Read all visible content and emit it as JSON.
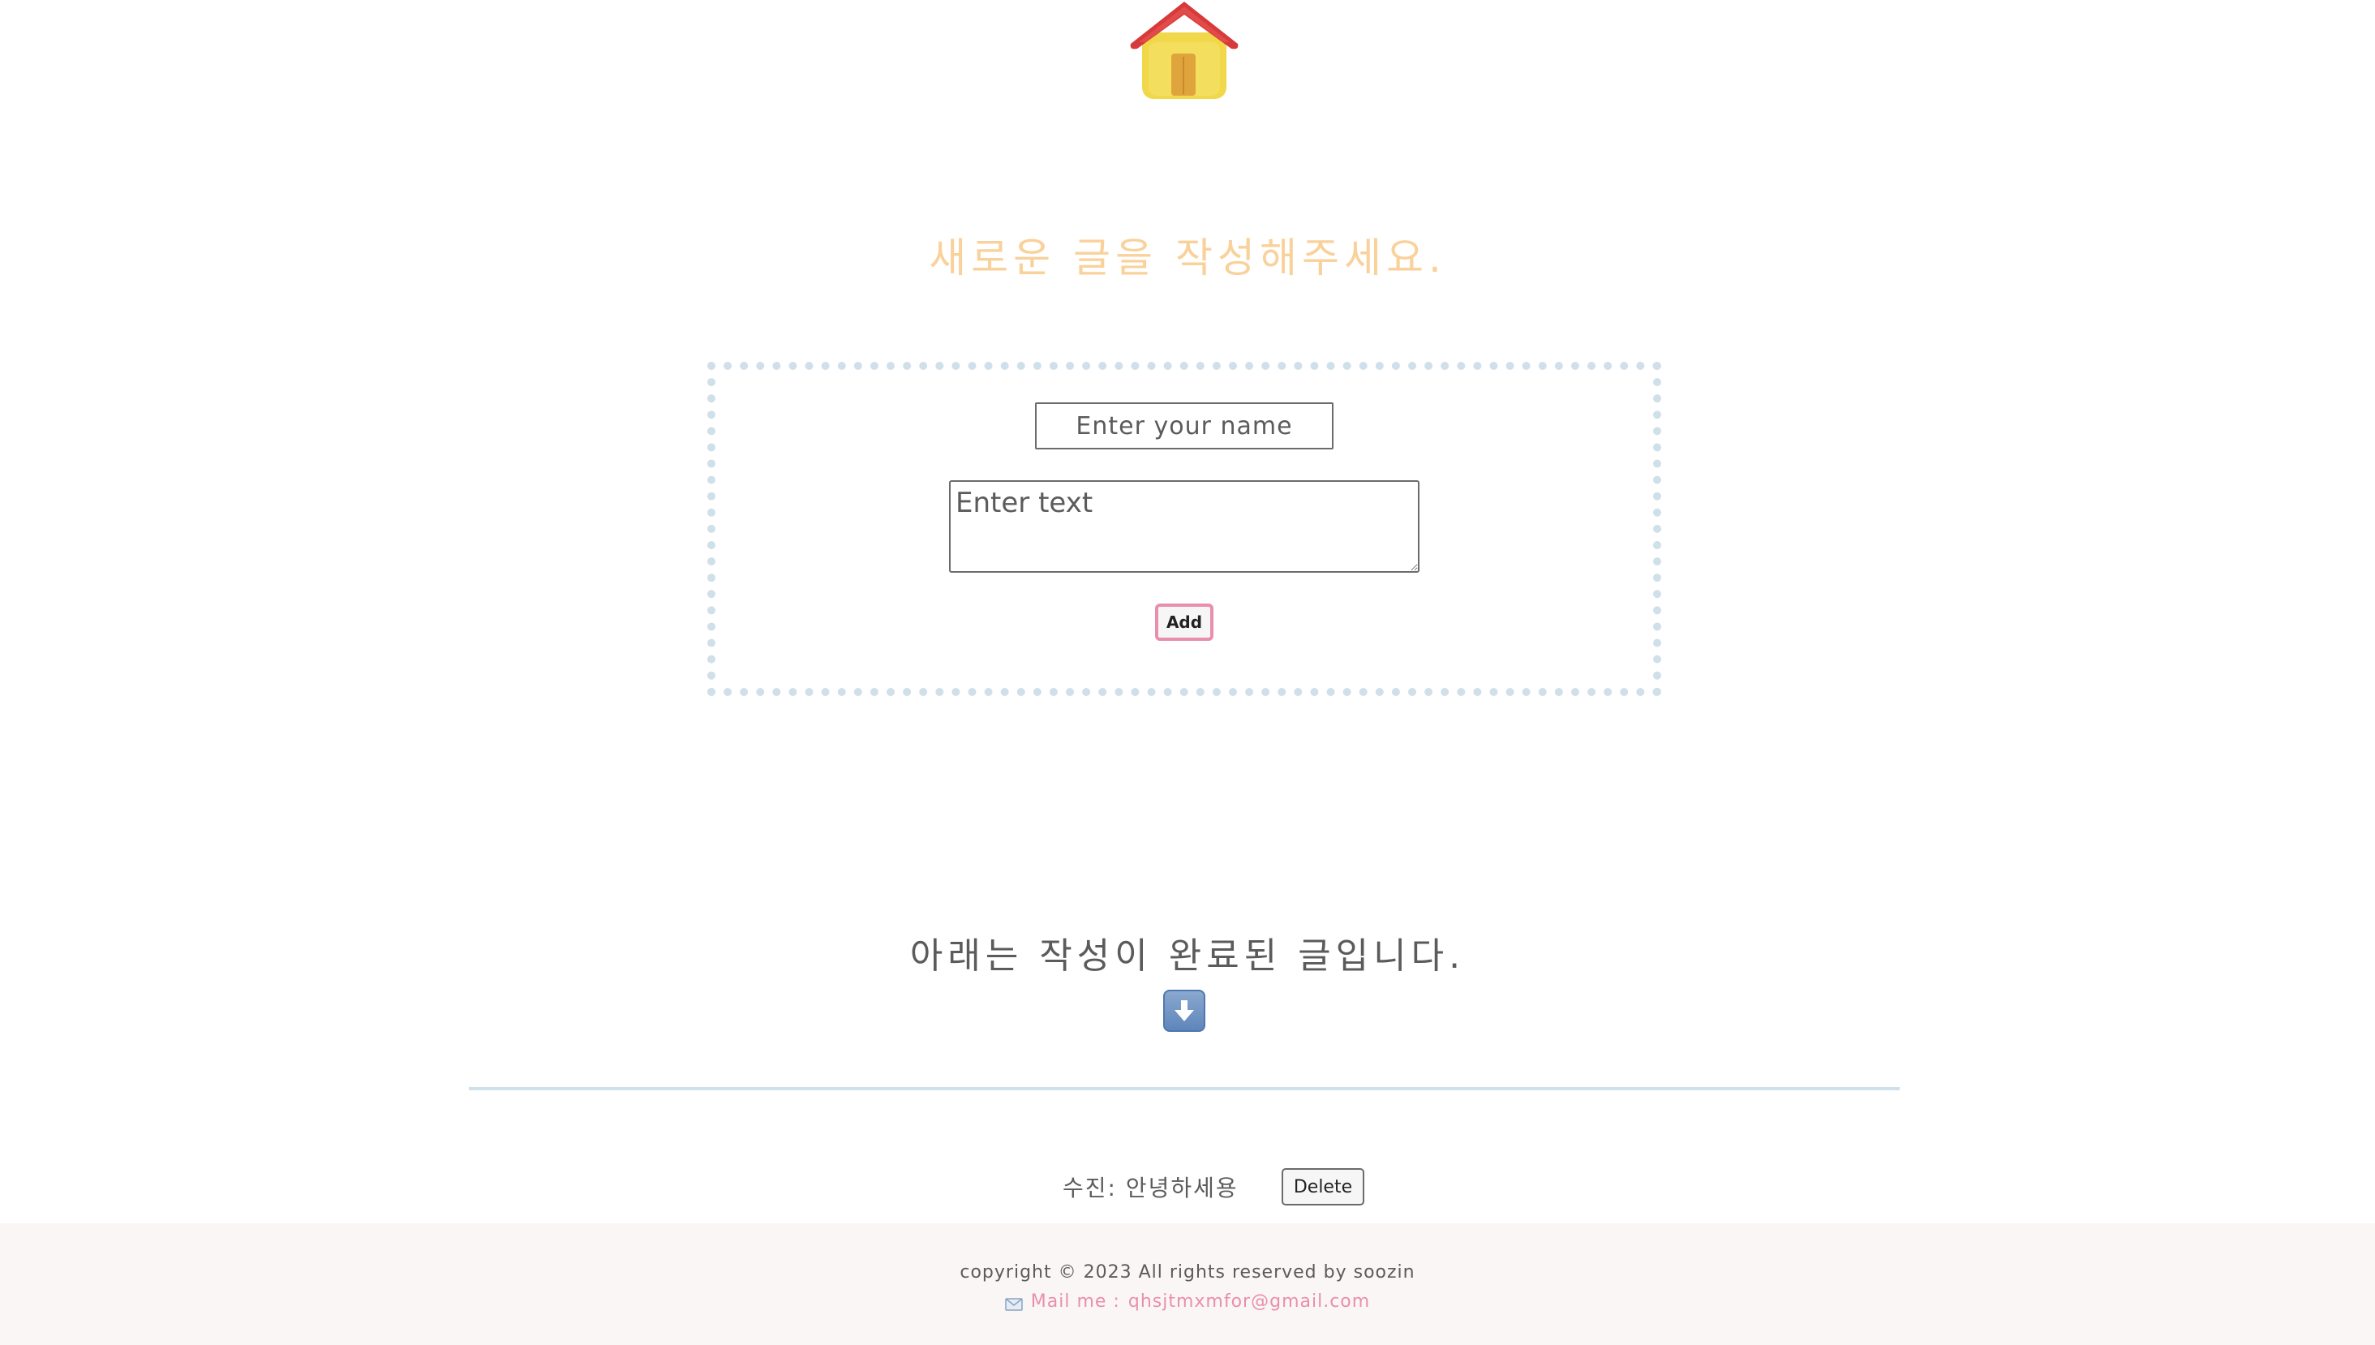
{
  "home": {
    "icon": "house-icon",
    "colors": {
      "roof": "#d63a3a",
      "walls": "#f1d84a",
      "door": "#e0a43c"
    }
  },
  "write_section": {
    "title": "새로운 글을 작성해주세요.",
    "title_color": "#f9d19a",
    "name_placeholder": "Enter your name",
    "name_value": "",
    "text_placeholder": "Enter text",
    "text_value": "",
    "add_label": "Add",
    "add_border_color": "#e98fab",
    "box_border_color": "#cfe0ea"
  },
  "list_section": {
    "title": "아래는 작성이 완료된 글입니다.",
    "arrow_icon": "down-arrow-icon",
    "posts": [
      {
        "text": "수진: 안녕하세용",
        "delete_label": "Delete"
      }
    ]
  },
  "footer": {
    "copyright": "copyright © 2023 All rights reserved by soozin",
    "mail_icon": "envelope-icon",
    "mail_label": "Mail me :",
    "mail_address": "qhsjtmxmfor@gmail.com",
    "accent_color": "#e98fab",
    "background": "#fbf6f6"
  }
}
